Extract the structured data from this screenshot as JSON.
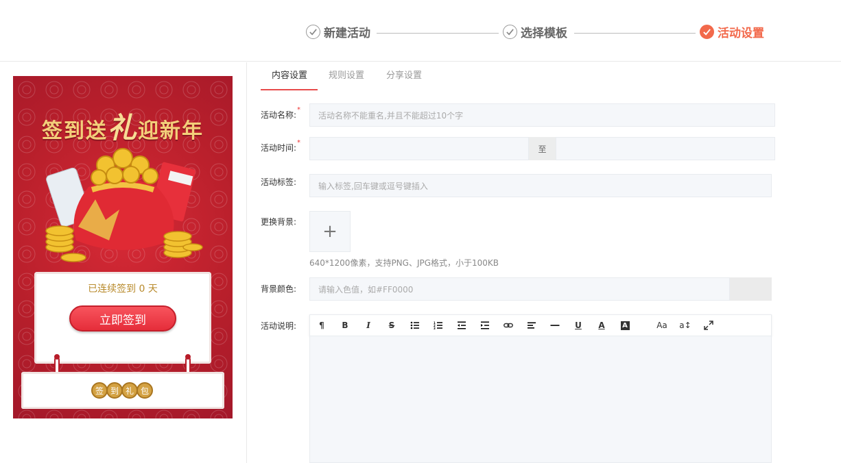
{
  "steps": [
    {
      "label": "新建活动",
      "state": "done"
    },
    {
      "label": "选择模板",
      "state": "done"
    },
    {
      "label": "活动设置",
      "state": "active"
    }
  ],
  "colors": {
    "accent": "#f2694b",
    "tab_underline": "#e84a4a",
    "poster_red": "#b81f2b",
    "gold": "#f3cf7a"
  },
  "preview": {
    "title_part1": "签到送",
    "title_big": "礼",
    "title_part2": "迎新年",
    "streak_text": "已连续签到 0 天",
    "signin_button": "立即签到",
    "gift_chars": [
      "签",
      "到",
      "礼",
      "包"
    ]
  },
  "tabs": [
    {
      "label": "内容设置",
      "active": true
    },
    {
      "label": "规则设置",
      "active": false
    },
    {
      "label": "分享设置",
      "active": false
    }
  ],
  "form": {
    "name_label": "活动名称:",
    "name_placeholder": "活动名称不能重名,并且不能超过10个字",
    "time_label": "活动时间:",
    "time_separator": "至",
    "tags_label": "活动标签:",
    "tags_placeholder": "输入标签,回车键或逗号键插入",
    "bg_label": "更换背景:",
    "upload_symbol": "+",
    "bg_hint": "640*1200像素，支持PNG、JPG格式，小于100KB",
    "color_label": "背景颜色:",
    "color_placeholder": "请输入色值，如#FF0000",
    "desc_label": "活动说明:",
    "required_mark": "*"
  },
  "toolbar": [
    {
      "name": "paragraph-icon",
      "glyph": "¶"
    },
    {
      "name": "bold-icon",
      "glyph": "B"
    },
    {
      "name": "italic-icon",
      "glyph": "I"
    },
    {
      "name": "strikethrough-icon",
      "glyph": "S"
    },
    {
      "name": "unordered-list-icon",
      "glyph": ""
    },
    {
      "name": "ordered-list-icon",
      "glyph": ""
    },
    {
      "name": "outdent-icon",
      "glyph": ""
    },
    {
      "name": "indent-icon",
      "glyph": ""
    },
    {
      "name": "link-icon",
      "glyph": ""
    },
    {
      "name": "align-left-icon",
      "glyph": ""
    },
    {
      "name": "horizontal-rule-icon",
      "glyph": ""
    },
    {
      "name": "underline-icon",
      "glyph": "U"
    },
    {
      "name": "font-color-icon",
      "glyph": "A"
    },
    {
      "name": "background-color-icon",
      "glyph": "A"
    },
    {
      "name": "font-size-icon",
      "glyph": "Aa"
    },
    {
      "name": "line-height-icon",
      "glyph": "a↕"
    },
    {
      "name": "fullscreen-icon",
      "glyph": ""
    }
  ]
}
